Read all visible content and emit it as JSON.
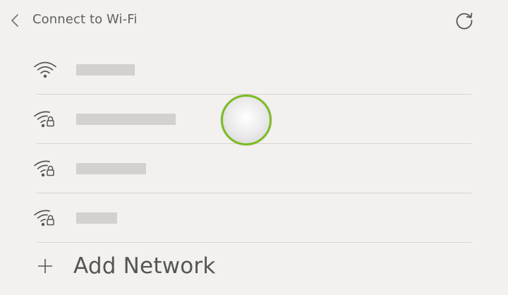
{
  "header": {
    "title": "Connect to Wi-Fi"
  },
  "networks": [
    {
      "ssid_redacted": true,
      "secured": false,
      "ssid_length": 0.4
    },
    {
      "ssid_redacted": true,
      "secured": true,
      "ssid_length": 0.68
    },
    {
      "ssid_redacted": true,
      "secured": true,
      "ssid_length": 0.48
    },
    {
      "ssid_redacted": true,
      "secured": true,
      "ssid_length": 0.28
    }
  ],
  "add_network": {
    "label": "Add Network"
  },
  "colors": {
    "background": "#f2f1ef",
    "text": "#555555",
    "divider": "#d6d5d3",
    "redaction": "#d2d1cf",
    "touch_ring": "#7dbb22"
  },
  "icons": {
    "back": "chevron-left-icon",
    "refresh": "refresh-icon",
    "open_network": "wifi-icon",
    "secured_network": "wifi-lock-icon",
    "add": "plus-icon"
  }
}
